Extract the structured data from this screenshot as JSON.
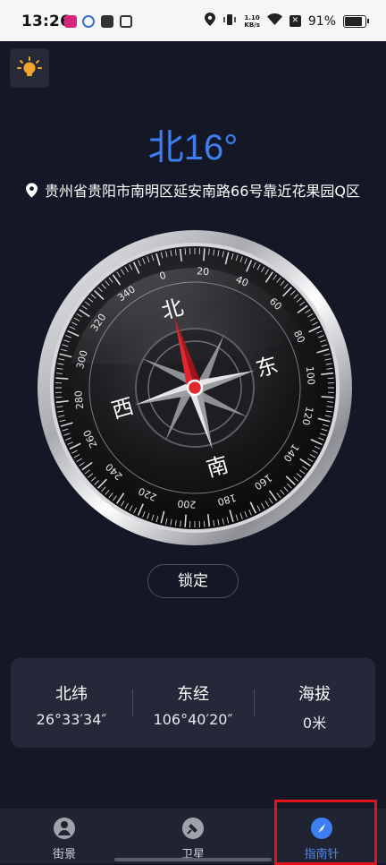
{
  "status_bar": {
    "time": "13:26",
    "network_speed_value": "1.10",
    "network_speed_unit": "KB/s",
    "battery": "91%",
    "battery_level": 0.91
  },
  "header": {
    "heading": "北16°",
    "address": "贵州省贵阳市南明区延安南路66号靠近花果园Q区",
    "heading_degrees": 16
  },
  "compass": {
    "cardinals": {
      "north": "北",
      "east": "东",
      "south": "南",
      "west": "西"
    },
    "ticks": [
      "0",
      "20",
      "40",
      "60",
      "80",
      "100",
      "120",
      "140",
      "160",
      "180",
      "200",
      "220",
      "240",
      "260",
      "280",
      "300",
      "320",
      "340"
    ],
    "rotation_degrees": -16
  },
  "lock_button": "锁定",
  "info": [
    {
      "label": "北纬",
      "value": "26°33′34″"
    },
    {
      "label": "东经",
      "value": "106°40′20″"
    },
    {
      "label": "海拔",
      "value": "0米"
    }
  ],
  "nav": [
    {
      "label": "街景",
      "icon": "street-view-icon"
    },
    {
      "label": "卫星",
      "icon": "satellite-icon"
    },
    {
      "label": "指南针",
      "icon": "compass-icon",
      "active": true
    }
  ],
  "colors": {
    "accent": "#3d7ff2",
    "background": "#141726",
    "needle_north": "#c8202a",
    "selection_frame": "#e0141c"
  }
}
